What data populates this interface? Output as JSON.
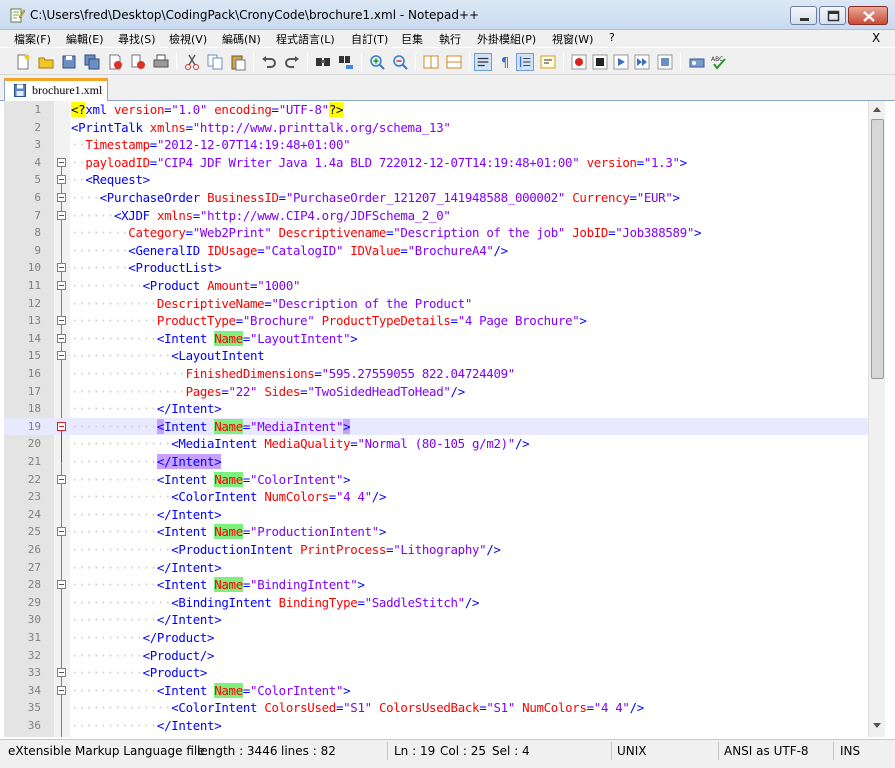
{
  "window": {
    "title": "C:\\Users\\fred\\Desktop\\CodingPack\\CronyCode\\brochure1.xml - Notepad++"
  },
  "menu": {
    "items": [
      "檔案(F)",
      "編輯(E)",
      "尋找(S)",
      "檢視(V)",
      "編碼(N)",
      "程式語言(L)",
      "自訂(T)",
      "巨集",
      "執行",
      "外掛模組(P)",
      "視窗(W)",
      "?"
    ],
    "close_glyph": "X"
  },
  "tabs": [
    {
      "label": "brochure1.xml",
      "active": true
    }
  ],
  "editor": {
    "current_line": 19,
    "lines": [
      {
        "n": "1",
        "segs": [
          [
            "pi",
            "<?"
          ],
          [
            "tag",
            "xml"
          ],
          [
            "txt",
            " "
          ],
          [
            "attr",
            "version"
          ],
          [
            "tag",
            "="
          ],
          [
            "val",
            "\"1.0\""
          ],
          [
            "txt",
            " "
          ],
          [
            "attr",
            "encoding"
          ],
          [
            "tag",
            "="
          ],
          [
            "val",
            "\"UTF-8\""
          ],
          [
            "pi",
            "?>"
          ]
        ]
      },
      {
        "n": "2",
        "segs": [
          [
            "tag",
            "<PrintTalk"
          ],
          [
            "txt",
            " "
          ],
          [
            "attr",
            "xmlns"
          ],
          [
            "tag",
            "="
          ],
          [
            "val",
            "\"http://www.printtalk.org/schema_13\""
          ]
        ]
      },
      {
        "n": "3",
        "segs": [
          [
            "ind",
            "  "
          ],
          [
            "attr",
            "Timestamp"
          ],
          [
            "tag",
            "="
          ],
          [
            "val",
            "\"2012-12-07T14:19:48+01:00\""
          ]
        ]
      },
      {
        "n": "4",
        "segs": [
          [
            "ind",
            "  "
          ],
          [
            "attr",
            "payloadID"
          ],
          [
            "tag",
            "="
          ],
          [
            "val",
            "\"CIP4 JDF Writer Java 1.4a BLD 722012-12-07T14:19:48+01:00\""
          ],
          [
            "txt",
            " "
          ],
          [
            "attr",
            "version"
          ],
          [
            "tag",
            "="
          ],
          [
            "val",
            "\"1.3\""
          ],
          [
            "tag",
            ">"
          ]
        ]
      },
      {
        "n": "5",
        "segs": [
          [
            "ind",
            "  "
          ],
          [
            "tag",
            "<Request>"
          ]
        ]
      },
      {
        "n": "6",
        "segs": [
          [
            "ind",
            "    "
          ],
          [
            "tag",
            "<PurchaseOrder"
          ],
          [
            "txt",
            " "
          ],
          [
            "attr",
            "BusinessID"
          ],
          [
            "tag",
            "="
          ],
          [
            "val",
            "\"PurchaseOrder_121207_141948588_000002\""
          ],
          [
            "txt",
            " "
          ],
          [
            "attr",
            "Currency"
          ],
          [
            "tag",
            "="
          ],
          [
            "val",
            "\"EUR\""
          ],
          [
            "tag",
            ">"
          ]
        ]
      },
      {
        "n": "7",
        "segs": [
          [
            "ind",
            "      "
          ],
          [
            "tag",
            "<XJDF"
          ],
          [
            "txt",
            " "
          ],
          [
            "attr",
            "xmlns"
          ],
          [
            "tag",
            "="
          ],
          [
            "val",
            "\"http://www.CIP4.org/JDFSchema_2_0\""
          ]
        ]
      },
      {
        "n": "8",
        "segs": [
          [
            "ind",
            "        "
          ],
          [
            "attr",
            "Category"
          ],
          [
            "tag",
            "="
          ],
          [
            "val",
            "\"Web2Print\""
          ],
          [
            "txt",
            " "
          ],
          [
            "attr",
            "Descriptivename"
          ],
          [
            "tag",
            "="
          ],
          [
            "val",
            "\"Description of the job\""
          ],
          [
            "txt",
            " "
          ],
          [
            "attr",
            "JobID"
          ],
          [
            "tag",
            "="
          ],
          [
            "val",
            "\"Job388589\""
          ],
          [
            "tag",
            ">"
          ]
        ]
      },
      {
        "n": "9",
        "segs": [
          [
            "ind",
            "        "
          ],
          [
            "tag",
            "<GeneralID"
          ],
          [
            "txt",
            " "
          ],
          [
            "attr",
            "IDUsage"
          ],
          [
            "tag",
            "="
          ],
          [
            "val",
            "\"CatalogID\""
          ],
          [
            "txt",
            " "
          ],
          [
            "attr",
            "IDValue"
          ],
          [
            "tag",
            "="
          ],
          [
            "val",
            "\"BrochureA4\""
          ],
          [
            "tag",
            "/>"
          ]
        ]
      },
      {
        "n": "10",
        "segs": [
          [
            "ind",
            "        "
          ],
          [
            "tag",
            "<ProductList>"
          ]
        ]
      },
      {
        "n": "11",
        "segs": [
          [
            "ind",
            "          "
          ],
          [
            "tag",
            "<Product"
          ],
          [
            "txt",
            " "
          ],
          [
            "attr",
            "Amount"
          ],
          [
            "tag",
            "="
          ],
          [
            "val",
            "\"1000\""
          ]
        ]
      },
      {
        "n": "12",
        "segs": [
          [
            "ind",
            "            "
          ],
          [
            "attr",
            "DescriptiveName"
          ],
          [
            "tag",
            "="
          ],
          [
            "val",
            "\"Description of the Product\""
          ]
        ]
      },
      {
        "n": "13",
        "segs": [
          [
            "ind",
            "            "
          ],
          [
            "attr",
            "ProductType"
          ],
          [
            "tag",
            "="
          ],
          [
            "val",
            "\"Brochure\""
          ],
          [
            "txt",
            " "
          ],
          [
            "attr",
            "ProductTypeDetails"
          ],
          [
            "tag",
            "="
          ],
          [
            "val",
            "\"4 Page Brochure\""
          ],
          [
            "tag",
            ">"
          ]
        ]
      },
      {
        "n": "14",
        "segs": [
          [
            "ind",
            "            "
          ],
          [
            "tag",
            "<Intent"
          ],
          [
            "txt",
            " "
          ],
          [
            "attrg",
            "Name"
          ],
          [
            "tag",
            "="
          ],
          [
            "val",
            "\"LayoutIntent\""
          ],
          [
            "tag",
            ">"
          ]
        ]
      },
      {
        "n": "15",
        "segs": [
          [
            "ind",
            "              "
          ],
          [
            "tag",
            "<LayoutIntent"
          ]
        ]
      },
      {
        "n": "16",
        "segs": [
          [
            "ind",
            "                "
          ],
          [
            "attr",
            "FinishedDimensions"
          ],
          [
            "tag",
            "="
          ],
          [
            "val",
            "\"595.27559055 822.04724409\""
          ]
        ]
      },
      {
        "n": "17",
        "segs": [
          [
            "ind",
            "                "
          ],
          [
            "attr",
            "Pages"
          ],
          [
            "tag",
            "="
          ],
          [
            "val",
            "\"22\""
          ],
          [
            "txt",
            " "
          ],
          [
            "attr",
            "Sides"
          ],
          [
            "tag",
            "="
          ],
          [
            "val",
            "\"TwoSidedHeadToHead\""
          ],
          [
            "tag",
            "/>"
          ]
        ]
      },
      {
        "n": "18",
        "segs": [
          [
            "ind",
            "            "
          ],
          [
            "tag",
            "</Intent>"
          ]
        ]
      },
      {
        "n": "19",
        "segs": [
          [
            "ind",
            "            "
          ],
          [
            "tagp",
            "<"
          ],
          [
            "tag",
            "Intent"
          ],
          [
            "txt",
            " "
          ],
          [
            "attrg",
            "Name"
          ],
          [
            "tag",
            "="
          ],
          [
            "val",
            "\"MediaIntent\""
          ],
          [
            "tagp",
            ">"
          ]
        ]
      },
      {
        "n": "20",
        "segs": [
          [
            "ind",
            "              "
          ],
          [
            "tag",
            "<MediaIntent"
          ],
          [
            "txt",
            " "
          ],
          [
            "attr",
            "MediaQuality"
          ],
          [
            "tag",
            "="
          ],
          [
            "val",
            "\"Normal (80-105 g/m2)\""
          ],
          [
            "tag",
            "/>"
          ]
        ]
      },
      {
        "n": "21",
        "segs": [
          [
            "ind",
            "            "
          ],
          [
            "tagp",
            "</Intent>"
          ]
        ]
      },
      {
        "n": "22",
        "segs": [
          [
            "ind",
            "            "
          ],
          [
            "tag",
            "<Intent"
          ],
          [
            "txt",
            " "
          ],
          [
            "attrg",
            "Name"
          ],
          [
            "tag",
            "="
          ],
          [
            "val",
            "\"ColorIntent\""
          ],
          [
            "tag",
            ">"
          ]
        ]
      },
      {
        "n": "23",
        "segs": [
          [
            "ind",
            "              "
          ],
          [
            "tag",
            "<ColorIntent"
          ],
          [
            "txt",
            " "
          ],
          [
            "attr",
            "NumColors"
          ],
          [
            "tag",
            "="
          ],
          [
            "val",
            "\"4 4\""
          ],
          [
            "tag",
            "/>"
          ]
        ]
      },
      {
        "n": "24",
        "segs": [
          [
            "ind",
            "            "
          ],
          [
            "tag",
            "</Intent>"
          ]
        ]
      },
      {
        "n": "25",
        "segs": [
          [
            "ind",
            "            "
          ],
          [
            "tag",
            "<Intent"
          ],
          [
            "txt",
            " "
          ],
          [
            "attrg",
            "Name"
          ],
          [
            "tag",
            "="
          ],
          [
            "val",
            "\"ProductionIntent\""
          ],
          [
            "tag",
            ">"
          ]
        ]
      },
      {
        "n": "26",
        "segs": [
          [
            "ind",
            "              "
          ],
          [
            "tag",
            "<ProductionIntent"
          ],
          [
            "txt",
            " "
          ],
          [
            "attr",
            "PrintProcess"
          ],
          [
            "tag",
            "="
          ],
          [
            "val",
            "\"Lithography\""
          ],
          [
            "tag",
            "/>"
          ]
        ]
      },
      {
        "n": "27",
        "segs": [
          [
            "ind",
            "            "
          ],
          [
            "tag",
            "</Intent>"
          ]
        ]
      },
      {
        "n": "28",
        "segs": [
          [
            "ind",
            "            "
          ],
          [
            "tag",
            "<Intent"
          ],
          [
            "txt",
            " "
          ],
          [
            "attrg",
            "Name"
          ],
          [
            "tag",
            "="
          ],
          [
            "val",
            "\"BindingIntent\""
          ],
          [
            "tag",
            ">"
          ]
        ]
      },
      {
        "n": "29",
        "segs": [
          [
            "ind",
            "              "
          ],
          [
            "tag",
            "<BindingIntent"
          ],
          [
            "txt",
            " "
          ],
          [
            "attr",
            "BindingType"
          ],
          [
            "tag",
            "="
          ],
          [
            "val",
            "\"SaddleStitch\""
          ],
          [
            "tag",
            "/>"
          ]
        ]
      },
      {
        "n": "30",
        "segs": [
          [
            "ind",
            "            "
          ],
          [
            "tag",
            "</Intent>"
          ]
        ]
      },
      {
        "n": "31",
        "segs": [
          [
            "ind",
            "          "
          ],
          [
            "tag",
            "</Product>"
          ]
        ]
      },
      {
        "n": "32",
        "segs": [
          [
            "ind",
            "          "
          ],
          [
            "tag",
            "<Product/>"
          ]
        ]
      },
      {
        "n": "33",
        "segs": [
          [
            "ind",
            "          "
          ],
          [
            "tag",
            "<Product>"
          ]
        ]
      },
      {
        "n": "34",
        "segs": [
          [
            "ind",
            "            "
          ],
          [
            "tag",
            "<Intent"
          ],
          [
            "txt",
            " "
          ],
          [
            "attrg",
            "Name"
          ],
          [
            "tag",
            "="
          ],
          [
            "val",
            "\"ColorIntent\""
          ],
          [
            "tag",
            ">"
          ]
        ]
      },
      {
        "n": "35",
        "segs": [
          [
            "ind",
            "              "
          ],
          [
            "tag",
            "<ColorIntent"
          ],
          [
            "txt",
            " "
          ],
          [
            "attr",
            "ColorsUsed"
          ],
          [
            "tag",
            "="
          ],
          [
            "val",
            "\"S1\""
          ],
          [
            "txt",
            " "
          ],
          [
            "attr",
            "ColorsUsedBack"
          ],
          [
            "tag",
            "="
          ],
          [
            "val",
            "\"S1\""
          ],
          [
            "txt",
            " "
          ],
          [
            "attr",
            "NumColors"
          ],
          [
            "tag",
            "="
          ],
          [
            "val",
            "\"4 4\""
          ],
          [
            "tag",
            "/>"
          ]
        ]
      },
      {
        "n": "36",
        "segs": [
          [
            "ind",
            "            "
          ],
          [
            "tag",
            "</Intent>"
          ]
        ]
      }
    ]
  },
  "status": {
    "file_type": "eXtensible Markup Language file",
    "length": "length : 3446",
    "lines": "lines : 82",
    "ln": "Ln : 19",
    "col": "Col : 25",
    "sel": "Sel : 4",
    "eol": "UNIX",
    "encoding": "ANSI as UTF-8",
    "mode": "INS"
  },
  "colors": {
    "tag": "#0000ff",
    "attribute": "#ff0000",
    "value": "#8000ff",
    "current_line": "#e8e8ff",
    "match_highlight": "#7ef07e",
    "brace_highlight": "#c8a0ff"
  }
}
